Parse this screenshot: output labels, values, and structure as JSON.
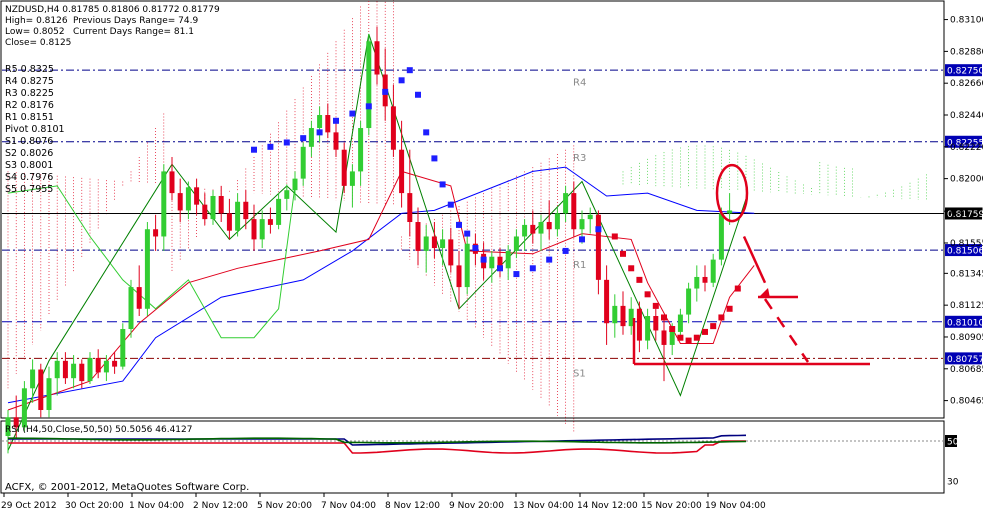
{
  "header": {
    "symbol_line": "NZDUSD,H4  0.81785 0.81806 0.81772 0.81779",
    "high": "High= 0.8126",
    "prev_range": "Previous Days Range= 74.9",
    "low": "Low= 0.8052",
    "curr_range": "Current Days Range= 81.1",
    "close": "Close= 0.8125"
  },
  "pivots": [
    {
      "text": "R5 0.8325"
    },
    {
      "text": "R4 0.8275"
    },
    {
      "text": "R3 0.8225"
    },
    {
      "text": "R2 0.8176"
    },
    {
      "text": "R1 0.8151"
    },
    {
      "text": "Pivot 0.8101"
    },
    {
      "text": "S1 0.8076"
    },
    {
      "text": "S2 0.8026"
    },
    {
      "text": "S3 0.8001"
    },
    {
      "text": "S4 0.7976"
    },
    {
      "text": "S5 0.7955"
    }
  ],
  "level_labels": [
    {
      "text": "R4",
      "price": 0.8267
    },
    {
      "text": "R3",
      "price": 0.8215
    },
    {
      "text": "R1",
      "price": 0.8141
    },
    {
      "text": "S1",
      "price": 0.8066
    }
  ],
  "watermark": "ACFX, © 2001-2012, MetaQuotes Software Corp.",
  "rsi_title": "RSI (H4,50,Close,50,50) 50.5056 46.4127",
  "colors": {
    "bull": "#32cd32",
    "bear": "#e0001c",
    "kijun_blue": "#0000ff",
    "tenkan_red": "#e0001c",
    "chikou": "#32cd32",
    "zigzag": "#008000",
    "price_box": "#0000b4",
    "marker": "#e0001c"
  },
  "chart_data": {
    "type": "candlestick",
    "title": "NZDUSD,H4",
    "ylim": [
      0.804,
      0.8318
    ],
    "y_ticks": [
      "0.83100",
      "0.82880",
      "0.82660",
      "0.82440",
      "0.82220",
      "0.82000",
      "0.81775",
      "0.81555",
      "0.81345",
      "0.81125",
      "0.80905",
      "0.80685",
      "0.80465"
    ],
    "x_ticks": [
      "29 Oct 2012",
      "30 Oct 20:00",
      "1 Nov 04:00",
      "2 Nov 12:00",
      "5 Nov 20:00",
      "7 Nov 04:00",
      "8 Nov 12:00",
      "9 Nov 20:00",
      "13 Nov 04:00",
      "14 Nov 12:00",
      "15 Nov 20:00",
      "19 Nov 04:00"
    ],
    "horizontal_levels": [
      {
        "price": 0.8275,
        "label": "0.82750",
        "style": "dashdot",
        "color": "#00008b"
      },
      {
        "price": 0.82255,
        "label": "0.82255",
        "style": "dashdot",
        "color": "#00008b"
      },
      {
        "price": 0.81759,
        "label": "0.81759",
        "style": "solid",
        "color": "#000000"
      },
      {
        "price": 0.81506,
        "label": "0.81506",
        "style": "dashdot",
        "color": "#00008b"
      },
      {
        "price": 0.8101,
        "label": "0.81010",
        "style": "dash",
        "color": "#0000b4"
      },
      {
        "price": 0.80757,
        "label": "0.80757",
        "style": "dashdot",
        "color": "#8b0000"
      }
    ],
    "current_price_box": "0.81759",
    "candles": [
      {
        "o": 0.8022,
        "h": 0.804,
        "l": 0.801,
        "c": 0.8035
      },
      {
        "o": 0.8035,
        "h": 0.805,
        "l": 0.802,
        "c": 0.8028
      },
      {
        "o": 0.8028,
        "h": 0.806,
        "l": 0.8025,
        "c": 0.8055
      },
      {
        "o": 0.8055,
        "h": 0.8075,
        "l": 0.8045,
        "c": 0.8068
      },
      {
        "o": 0.8068,
        "h": 0.8072,
        "l": 0.8035,
        "c": 0.804
      },
      {
        "o": 0.804,
        "h": 0.807,
        "l": 0.8035,
        "c": 0.8062
      },
      {
        "o": 0.8062,
        "h": 0.808,
        "l": 0.805,
        "c": 0.8074
      },
      {
        "o": 0.8074,
        "h": 0.808,
        "l": 0.8058,
        "c": 0.8062
      },
      {
        "o": 0.8062,
        "h": 0.8078,
        "l": 0.8055,
        "c": 0.8072
      },
      {
        "o": 0.8072,
        "h": 0.8075,
        "l": 0.8055,
        "c": 0.806
      },
      {
        "o": 0.806,
        "h": 0.808,
        "l": 0.8058,
        "c": 0.8076
      },
      {
        "o": 0.8076,
        "h": 0.8082,
        "l": 0.8062,
        "c": 0.8066
      },
      {
        "o": 0.8066,
        "h": 0.8078,
        "l": 0.806,
        "c": 0.8074
      },
      {
        "o": 0.8074,
        "h": 0.808,
        "l": 0.8065,
        "c": 0.807
      },
      {
        "o": 0.807,
        "h": 0.81,
        "l": 0.8068,
        "c": 0.8096
      },
      {
        "o": 0.8096,
        "h": 0.813,
        "l": 0.809,
        "c": 0.8125
      },
      {
        "o": 0.8125,
        "h": 0.814,
        "l": 0.8105,
        "c": 0.811
      },
      {
        "o": 0.811,
        "h": 0.817,
        "l": 0.8105,
        "c": 0.8165
      },
      {
        "o": 0.8165,
        "h": 0.8175,
        "l": 0.815,
        "c": 0.816
      },
      {
        "o": 0.816,
        "h": 0.821,
        "l": 0.815,
        "c": 0.8205
      },
      {
        "o": 0.8205,
        "h": 0.8215,
        "l": 0.8185,
        "c": 0.819
      },
      {
        "o": 0.819,
        "h": 0.82,
        "l": 0.817,
        "c": 0.8178
      },
      {
        "o": 0.8178,
        "h": 0.8198,
        "l": 0.8172,
        "c": 0.8194
      },
      {
        "o": 0.8194,
        "h": 0.82,
        "l": 0.8175,
        "c": 0.8182
      },
      {
        "o": 0.8182,
        "h": 0.819,
        "l": 0.8168,
        "c": 0.8172
      },
      {
        "o": 0.8172,
        "h": 0.8192,
        "l": 0.8168,
        "c": 0.8188
      },
      {
        "o": 0.8188,
        "h": 0.8195,
        "l": 0.817,
        "c": 0.8176
      },
      {
        "o": 0.8176,
        "h": 0.8186,
        "l": 0.8158,
        "c": 0.8164
      },
      {
        "o": 0.8164,
        "h": 0.819,
        "l": 0.816,
        "c": 0.8184
      },
      {
        "o": 0.8184,
        "h": 0.8192,
        "l": 0.8165,
        "c": 0.8172
      },
      {
        "o": 0.8172,
        "h": 0.8182,
        "l": 0.815,
        "c": 0.8158
      },
      {
        "o": 0.8158,
        "h": 0.8178,
        "l": 0.8152,
        "c": 0.8172
      },
      {
        "o": 0.8172,
        "h": 0.818,
        "l": 0.8162,
        "c": 0.8168
      },
      {
        "o": 0.8168,
        "h": 0.819,
        "l": 0.8165,
        "c": 0.8186
      },
      {
        "o": 0.8186,
        "h": 0.8196,
        "l": 0.8178,
        "c": 0.8192
      },
      {
        "o": 0.8192,
        "h": 0.8205,
        "l": 0.8185,
        "c": 0.82
      },
      {
        "o": 0.82,
        "h": 0.8225,
        "l": 0.8195,
        "c": 0.8222
      },
      {
        "o": 0.8222,
        "h": 0.824,
        "l": 0.8215,
        "c": 0.8235
      },
      {
        "o": 0.8235,
        "h": 0.825,
        "l": 0.8225,
        "c": 0.8244
      },
      {
        "o": 0.8244,
        "h": 0.8252,
        "l": 0.8228,
        "c": 0.8232
      },
      {
        "o": 0.8232,
        "h": 0.8242,
        "l": 0.8215,
        "c": 0.822
      },
      {
        "o": 0.822,
        "h": 0.8225,
        "l": 0.819,
        "c": 0.8195
      },
      {
        "o": 0.8195,
        "h": 0.821,
        "l": 0.818,
        "c": 0.8205
      },
      {
        "o": 0.8205,
        "h": 0.824,
        "l": 0.8195,
        "c": 0.8235
      },
      {
        "o": 0.8235,
        "h": 0.83,
        "l": 0.823,
        "c": 0.8295
      },
      {
        "o": 0.8295,
        "h": 0.8305,
        "l": 0.8265,
        "c": 0.8272
      },
      {
        "o": 0.8272,
        "h": 0.829,
        "l": 0.824,
        "c": 0.825
      },
      {
        "o": 0.825,
        "h": 0.8265,
        "l": 0.8215,
        "c": 0.822
      },
      {
        "o": 0.822,
        "h": 0.824,
        "l": 0.818,
        "c": 0.819
      },
      {
        "o": 0.819,
        "h": 0.822,
        "l": 0.816,
        "c": 0.817
      },
      {
        "o": 0.817,
        "h": 0.818,
        "l": 0.814,
        "c": 0.815
      },
      {
        "o": 0.815,
        "h": 0.8168,
        "l": 0.8135,
        "c": 0.816
      },
      {
        "o": 0.816,
        "h": 0.817,
        "l": 0.8145,
        "c": 0.8152
      },
      {
        "o": 0.8152,
        "h": 0.8165,
        "l": 0.814,
        "c": 0.8158
      },
      {
        "o": 0.8158,
        "h": 0.8166,
        "l": 0.8135,
        "c": 0.814
      },
      {
        "o": 0.814,
        "h": 0.815,
        "l": 0.811,
        "c": 0.8125
      },
      {
        "o": 0.8125,
        "h": 0.816,
        "l": 0.812,
        "c": 0.8155
      },
      {
        "o": 0.8155,
        "h": 0.8162,
        "l": 0.814,
        "c": 0.8148
      },
      {
        "o": 0.8148,
        "h": 0.8156,
        "l": 0.813,
        "c": 0.8138
      },
      {
        "o": 0.8138,
        "h": 0.815,
        "l": 0.8128,
        "c": 0.8146
      },
      {
        "o": 0.8146,
        "h": 0.8152,
        "l": 0.8132,
        "c": 0.8138
      },
      {
        "o": 0.8138,
        "h": 0.8154,
        "l": 0.813,
        "c": 0.815
      },
      {
        "o": 0.815,
        "h": 0.8165,
        "l": 0.8145,
        "c": 0.816
      },
      {
        "o": 0.816,
        "h": 0.8172,
        "l": 0.815,
        "c": 0.8168
      },
      {
        "o": 0.8168,
        "h": 0.8178,
        "l": 0.8155,
        "c": 0.8162
      },
      {
        "o": 0.8162,
        "h": 0.8175,
        "l": 0.815,
        "c": 0.817
      },
      {
        "o": 0.817,
        "h": 0.8185,
        "l": 0.8158,
        "c": 0.8165
      },
      {
        "o": 0.8165,
        "h": 0.818,
        "l": 0.816,
        "c": 0.8176
      },
      {
        "o": 0.8176,
        "h": 0.8195,
        "l": 0.817,
        "c": 0.819
      },
      {
        "o": 0.819,
        "h": 0.8198,
        "l": 0.816,
        "c": 0.8165
      },
      {
        "o": 0.8165,
        "h": 0.8178,
        "l": 0.8155,
        "c": 0.8172
      },
      {
        "o": 0.8172,
        "h": 0.818,
        "l": 0.8162,
        "c": 0.8175
      },
      {
        "o": 0.8175,
        "h": 0.8178,
        "l": 0.812,
        "c": 0.813
      },
      {
        "o": 0.813,
        "h": 0.814,
        "l": 0.8085,
        "c": 0.81
      },
      {
        "o": 0.81,
        "h": 0.812,
        "l": 0.809,
        "c": 0.8112
      },
      {
        "o": 0.8112,
        "h": 0.8122,
        "l": 0.8092,
        "c": 0.8098
      },
      {
        "o": 0.8098,
        "h": 0.8118,
        "l": 0.8092,
        "c": 0.811
      },
      {
        "o": 0.811,
        "h": 0.8115,
        "l": 0.808,
        "c": 0.8088
      },
      {
        "o": 0.8088,
        "h": 0.811,
        "l": 0.8082,
        "c": 0.8105
      },
      {
        "o": 0.8105,
        "h": 0.811,
        "l": 0.8088,
        "c": 0.8095
      },
      {
        "o": 0.8095,
        "h": 0.8102,
        "l": 0.806,
        "c": 0.8085
      },
      {
        "o": 0.8085,
        "h": 0.81,
        "l": 0.8078,
        "c": 0.8094
      },
      {
        "o": 0.8094,
        "h": 0.811,
        "l": 0.8088,
        "c": 0.8106
      },
      {
        "o": 0.8106,
        "h": 0.8128,
        "l": 0.81,
        "c": 0.8124
      },
      {
        "o": 0.8124,
        "h": 0.814,
        "l": 0.8115,
        "c": 0.8132
      },
      {
        "o": 0.8132,
        "h": 0.814,
        "l": 0.8122,
        "c": 0.8128
      },
      {
        "o": 0.8128,
        "h": 0.8148,
        "l": 0.8125,
        "c": 0.8144
      },
      {
        "o": 0.8144,
        "h": 0.818,
        "l": 0.814,
        "c": 0.8176
      },
      {
        "o": 0.8176,
        "h": 0.819,
        "l": 0.8168,
        "c": 0.8178
      }
    ],
    "zigzag": [
      [
        0,
        0.8012
      ],
      [
        5,
        0.8074
      ],
      [
        20,
        0.821
      ],
      [
        27,
        0.8158
      ],
      [
        34,
        0.8195
      ],
      [
        40,
        0.8163
      ],
      [
        44,
        0.83
      ],
      [
        55,
        0.811
      ],
      [
        70,
        0.8198
      ],
      [
        82,
        0.805
      ],
      [
        90,
        0.8186
      ]
    ],
    "kijun_blue": [
      [
        0,
        0.8045
      ],
      [
        14,
        0.806
      ],
      [
        18,
        0.809
      ],
      [
        26,
        0.8118
      ],
      [
        36,
        0.813
      ],
      [
        42,
        0.815
      ],
      [
        48,
        0.8176
      ],
      [
        52,
        0.8178
      ],
      [
        64,
        0.8205
      ],
      [
        68,
        0.8208
      ],
      [
        73,
        0.8188
      ],
      [
        78,
        0.819
      ],
      [
        84,
        0.8178
      ],
      [
        91,
        0.8176
      ]
    ],
    "tenkan_red": [
      [
        0,
        0.804
      ],
      [
        10,
        0.806
      ],
      [
        16,
        0.81
      ],
      [
        22,
        0.8128
      ],
      [
        28,
        0.8138
      ],
      [
        38,
        0.815
      ],
      [
        44,
        0.8158
      ],
      [
        48,
        0.8205
      ],
      [
        54,
        0.8195
      ],
      [
        56,
        0.815
      ],
      [
        64,
        0.8148
      ],
      [
        70,
        0.8162
      ],
      [
        76,
        0.8158
      ],
      [
        78,
        0.8128
      ],
      [
        82,
        0.8086
      ],
      [
        86,
        0.8086
      ],
      [
        88,
        0.8118
      ],
      [
        91,
        0.814
      ]
    ],
    "chikou": [
      [
        0,
        0.819
      ],
      [
        6,
        0.8195
      ],
      [
        10,
        0.816
      ],
      [
        14,
        0.813
      ],
      [
        18,
        0.811
      ],
      [
        22,
        0.813
      ],
      [
        26,
        0.809
      ],
      [
        30,
        0.809
      ],
      [
        33,
        0.811
      ],
      [
        35,
        0.8195
      ]
    ],
    "parabolic_sar": [
      [
        30,
        0.822
      ],
      [
        32,
        0.8222
      ],
      [
        34,
        0.8225
      ],
      [
        36,
        0.8228
      ],
      [
        38,
        0.8232
      ],
      [
        40,
        0.824
      ],
      [
        42,
        0.8245
      ],
      [
        44,
        0.825
      ],
      [
        46,
        0.826
      ],
      [
        48,
        0.8268
      ],
      [
        49,
        0.8275
      ],
      [
        50,
        0.8258
      ],
      [
        51,
        0.8232
      ],
      [
        52,
        0.8214
      ],
      [
        53,
        0.8196
      ],
      [
        54,
        0.8182
      ],
      [
        55,
        0.8168
      ],
      [
        56,
        0.8162
      ],
      [
        57,
        0.8152
      ],
      [
        58,
        0.8144
      ],
      [
        60,
        0.8138
      ],
      [
        62,
        0.8134
      ],
      [
        64,
        0.8138
      ],
      [
        66,
        0.8144
      ],
      [
        68,
        0.815
      ],
      [
        70,
        0.8158
      ],
      [
        72,
        0.8165
      ],
      [
        74,
        0.816
      ],
      [
        75,
        0.8148
      ],
      [
        76,
        0.8138
      ],
      [
        77,
        0.813
      ],
      [
        78,
        0.812
      ],
      [
        79,
        0.8112
      ],
      [
        80,
        0.8104
      ],
      [
        81,
        0.8096
      ],
      [
        82,
        0.809
      ],
      [
        83,
        0.8088
      ],
      [
        84,
        0.809
      ],
      [
        85,
        0.8094
      ],
      [
        86,
        0.8098
      ],
      [
        87,
        0.8104
      ],
      [
        88,
        0.811
      ],
      [
        89,
        0.8124
      ]
    ],
    "rsi_ticks": [
      "50",
      "30"
    ]
  }
}
